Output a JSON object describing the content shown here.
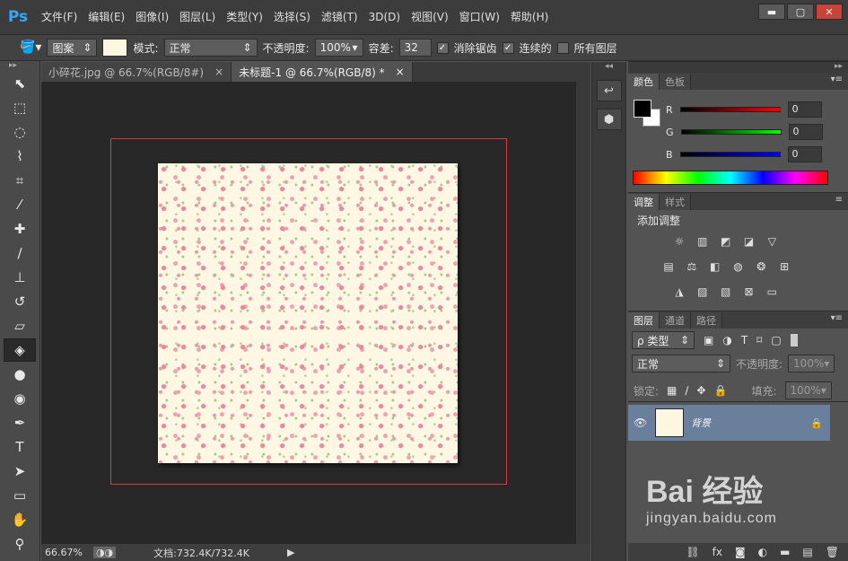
{
  "app": {
    "logo": "Ps"
  },
  "menu": [
    "文件(F)",
    "编辑(E)",
    "图像(I)",
    "图层(L)",
    "类型(Y)",
    "选择(S)",
    "滤镜(T)",
    "3D(D)",
    "视图(V)",
    "窗口(W)",
    "帮助(H)"
  ],
  "window_controls": {
    "minimize": "▬",
    "maximize": "▢",
    "close": "✕"
  },
  "options": {
    "fill_source": "图案",
    "mode_label": "模式:",
    "mode_value": "正常",
    "opacity_label": "不透明度:",
    "opacity_value": "100%",
    "tolerance_label": "容差:",
    "tolerance_value": "32",
    "antialias_label": "消除锯齿",
    "contiguous_label": "连续的",
    "all_layers_label": "所有图层"
  },
  "tabs": [
    {
      "label": "小碎花.jpg @ 66.7%(RGB/8#)",
      "close": "×"
    },
    {
      "label": "未标题-1 @ 66.7%(RGB/8) *",
      "close": "×"
    }
  ],
  "status": {
    "zoom": "66.67%",
    "doc_info": "文档:732.4K/732.4K"
  },
  "color_panel": {
    "tabs": [
      "颜色",
      "色板"
    ],
    "channels": [
      {
        "label": "R",
        "value": "0"
      },
      {
        "label": "G",
        "value": "0"
      },
      {
        "label": "B",
        "value": "0"
      }
    ]
  },
  "adjust_panel": {
    "tabs": [
      "调整",
      "样式"
    ],
    "title": "添加调整"
  },
  "layers_panel": {
    "tabs": [
      "图层",
      "通道",
      "路径"
    ],
    "filter_label": "ρ 类型",
    "blend_mode": "正常",
    "opacity_label": "不透明度:",
    "opacity_value": "100%",
    "lock_label": "锁定:",
    "fill_label": "填充:",
    "fill_value": "100%",
    "layer_name": "背景"
  },
  "watermark": {
    "brand": "Bai  经验",
    "url": "jingyan.baidu.com"
  }
}
